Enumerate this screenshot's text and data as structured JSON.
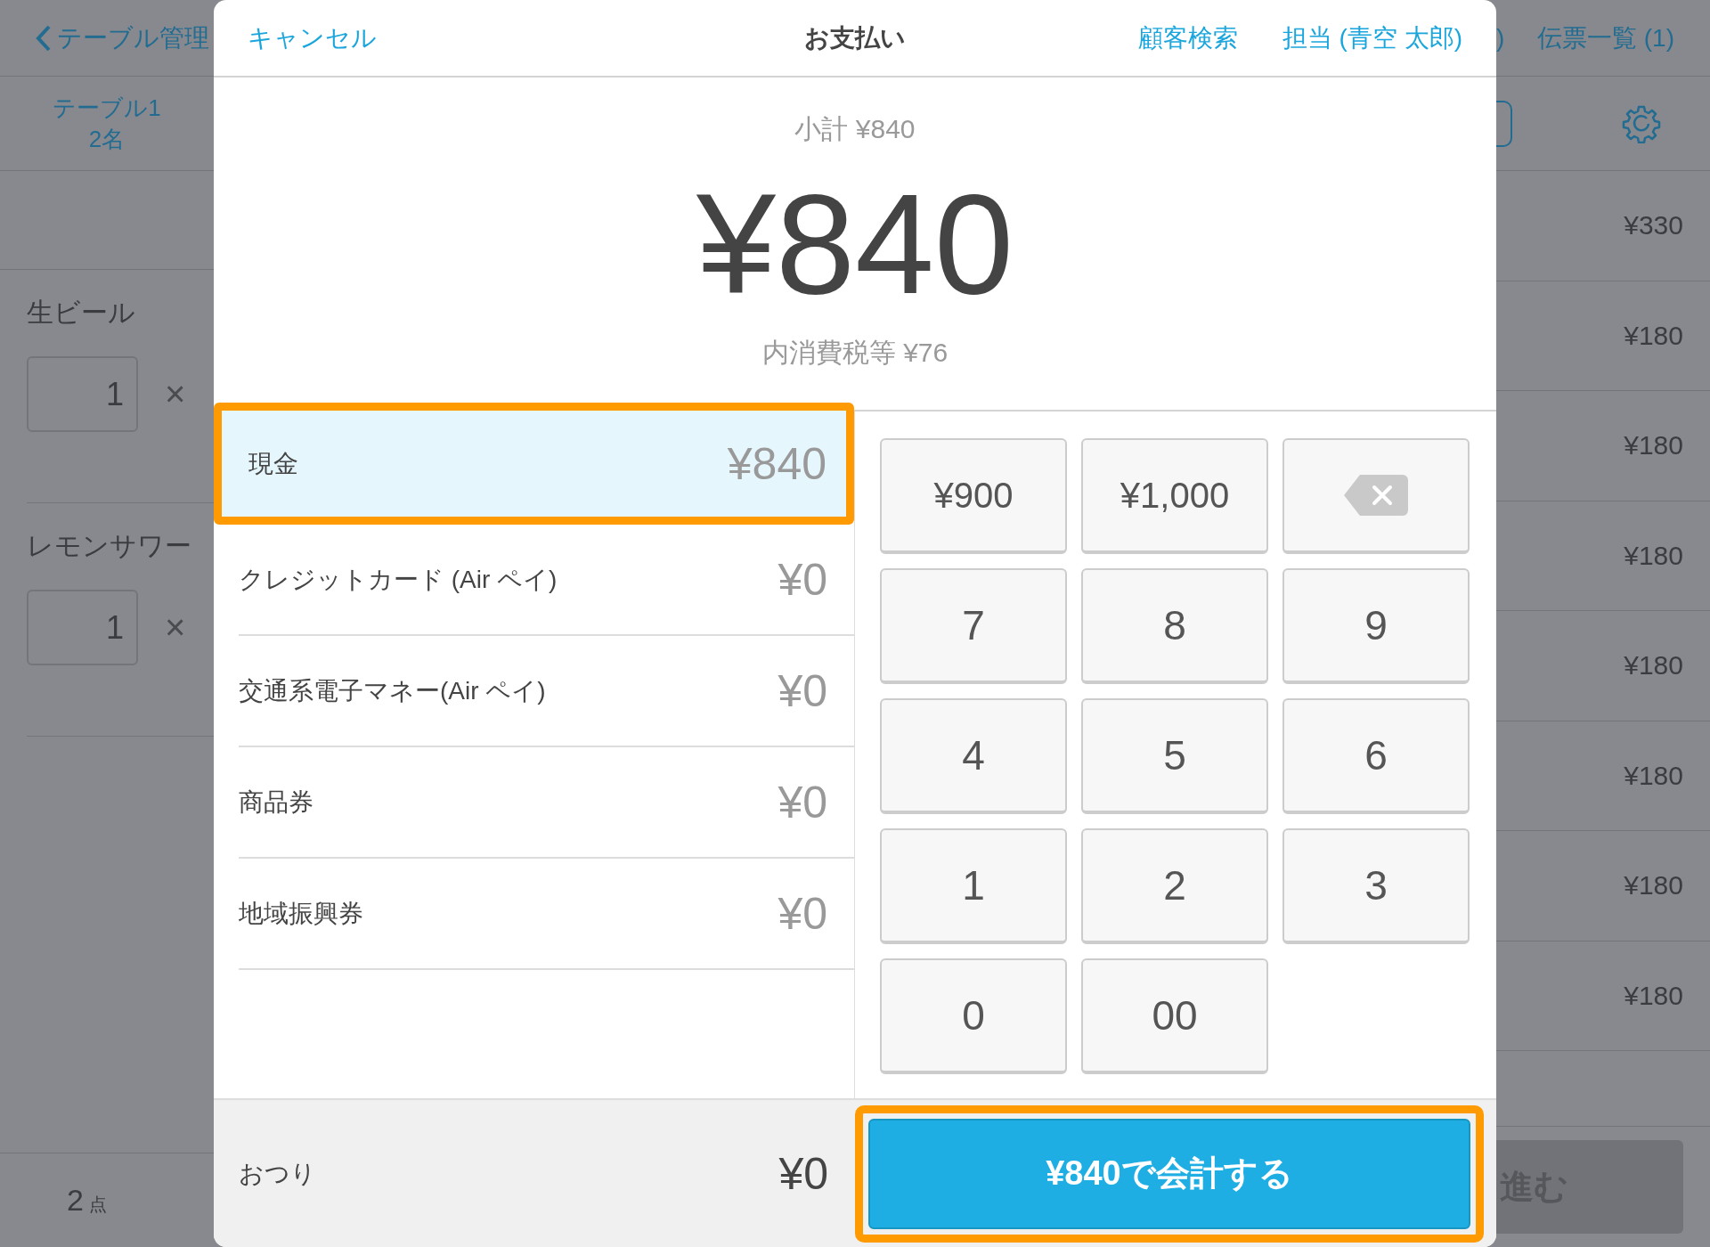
{
  "background": {
    "left": {
      "back_link": "テーブル管理",
      "table": "テーブル1",
      "guests": "2名",
      "items": [
        {
          "name": "生ビール",
          "quantity": "1",
          "remove": "×"
        },
        {
          "name": "レモンサワー",
          "quantity": "1",
          "remove": "×"
        }
      ],
      "count": "2",
      "count_unit": "点"
    },
    "right": {
      "header_fragment": ")",
      "slips_link": "伝票一覧 (1)",
      "prices": [
        "¥330",
        "¥180",
        "¥180",
        "¥180",
        "¥180",
        "¥180",
        "¥180",
        "¥180"
      ],
      "next_button": "進む"
    }
  },
  "dialog": {
    "header": {
      "cancel": "キャンセル",
      "title": "お支払い",
      "customer_search": "顧客検索",
      "staff": "担当 (青空 太郎)"
    },
    "subtotal": "小計 ¥840",
    "total": "¥840",
    "tax": "内消費税等 ¥76",
    "payment_methods": [
      {
        "label": "現金",
        "amount": "¥840",
        "selected": true
      },
      {
        "label": "クレジットカード (Air ペイ)",
        "amount": "¥0",
        "selected": false
      },
      {
        "label": "交通系電子マネー(Air ペイ)",
        "amount": "¥0",
        "selected": false
      },
      {
        "label": "商品券",
        "amount": "¥0",
        "selected": false
      },
      {
        "label": "地域振興券",
        "amount": "¥0",
        "selected": false
      }
    ],
    "keypad": [
      {
        "kind": "amount",
        "label": "¥900"
      },
      {
        "kind": "amount",
        "label": "¥1,000"
      },
      {
        "kind": "backspace"
      },
      {
        "kind": "digit",
        "label": "7"
      },
      {
        "kind": "digit",
        "label": "8"
      },
      {
        "kind": "digit",
        "label": "9"
      },
      {
        "kind": "digit",
        "label": "4"
      },
      {
        "kind": "digit",
        "label": "5"
      },
      {
        "kind": "digit",
        "label": "6"
      },
      {
        "kind": "digit",
        "label": "1"
      },
      {
        "kind": "digit",
        "label": "2"
      },
      {
        "kind": "digit",
        "label": "3"
      },
      {
        "kind": "digit",
        "label": "0"
      },
      {
        "kind": "digit",
        "label": "00"
      }
    ],
    "change": {
      "label": "おつり",
      "amount": "¥0"
    },
    "checkout_button": {
      "label": "¥840で会計する",
      "highlighted": true
    }
  }
}
